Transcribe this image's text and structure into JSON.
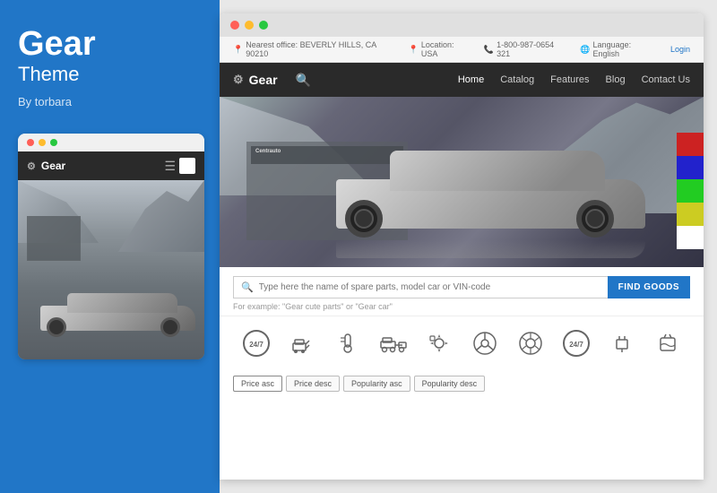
{
  "left": {
    "title": "Gear",
    "subtitle": "Theme",
    "author": "By torbara",
    "mobile": {
      "dots": [
        "red",
        "yellow",
        "green"
      ],
      "brand": "Gear"
    }
  },
  "browser": {
    "dots": [
      "red",
      "yellow",
      "green"
    ],
    "topbar": {
      "office": "Nearest office: BEVERLY HILLS, CA 90210",
      "location": "Location: USA",
      "phone": "1-800-987-0654 321",
      "language": "Language: English",
      "login": "Login"
    },
    "navbar": {
      "brand": "Gear",
      "links": [
        "Home",
        "Catalog",
        "Features",
        "Blog",
        "Contact Us"
      ]
    },
    "search": {
      "placeholder": "Type here the name of spare parts, model car or VIN-code",
      "button": "FIND GOODS",
      "example": "For example: \"Gear cute parts\" or \"Gear car\""
    },
    "filters": [
      "Price asc",
      "Price desc",
      "Popularity asc",
      "Popularity desc"
    ]
  }
}
